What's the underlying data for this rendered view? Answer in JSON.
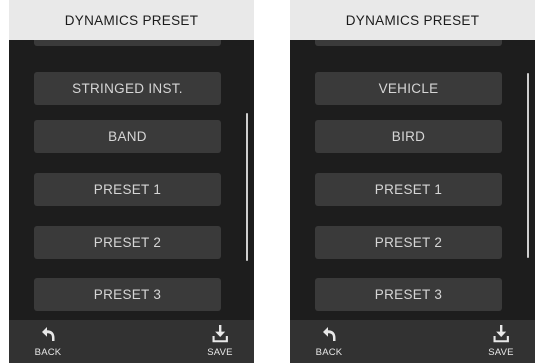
{
  "screens": [
    {
      "header": {
        "title": "DYNAMICS PRESET"
      },
      "list": {
        "items": [
          {
            "label": ""
          },
          {
            "label": "STRINGED INST."
          },
          {
            "label": "BAND"
          },
          {
            "label": "PRESET 1"
          },
          {
            "label": "PRESET 2"
          },
          {
            "label": "PRESET 3"
          }
        ]
      },
      "scrollbar": {
        "position_fraction": 0.55,
        "visible_fraction": 0.53
      },
      "footer": {
        "back": {
          "label": "BACK",
          "icon": "back-arrow-icon"
        },
        "save": {
          "label": "SAVE",
          "icon": "save-download-icon"
        }
      }
    },
    {
      "header": {
        "title": "DYNAMICS PRESET"
      },
      "list": {
        "items": [
          {
            "label": ""
          },
          {
            "label": "VEHICLE"
          },
          {
            "label": "BIRD"
          },
          {
            "label": "PRESET 1"
          },
          {
            "label": "PRESET 2"
          },
          {
            "label": "PRESET 3"
          }
        ]
      },
      "scrollbar": {
        "position_fraction": 0.35,
        "visible_fraction": 0.66
      },
      "footer": {
        "back": {
          "label": "BACK",
          "icon": "back-arrow-icon"
        },
        "save": {
          "label": "SAVE",
          "icon": "save-download-icon"
        }
      }
    }
  ],
  "colors": {
    "background": "#1d1d1d",
    "header_bg": "#e9e9e9",
    "button_bg": "#3a3a3a",
    "button_text": "#d6d6d6",
    "footer_bg": "#323232"
  }
}
